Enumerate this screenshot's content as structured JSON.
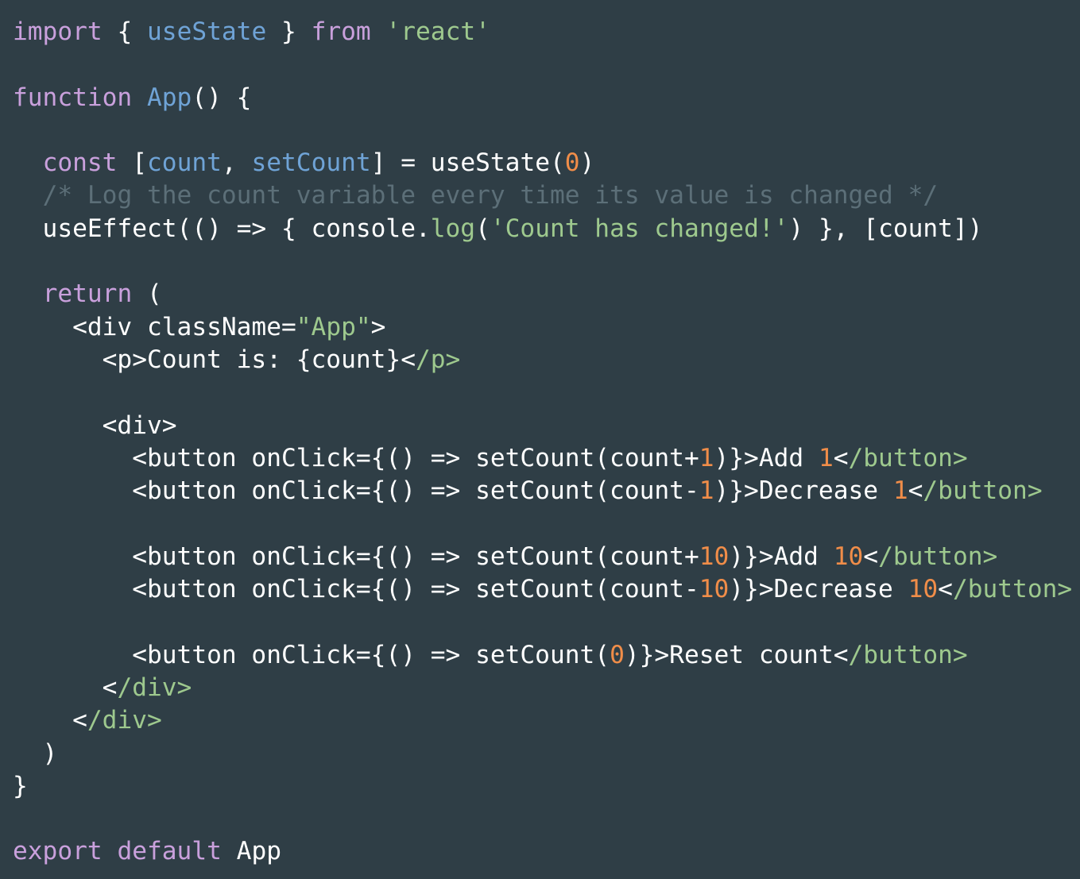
{
  "editor": {
    "background": "#2f3e46",
    "colors": {
      "keyword": "#c9a0dc",
      "identifier": "#6fa3d6",
      "string": "#9ec98e",
      "number": "#f08d49",
      "comment": "#5c6f78",
      "plain": "#ffffff"
    },
    "lines": [
      [
        [
          "keyword",
          "import"
        ],
        [
          "plain",
          " { "
        ],
        [
          "identifier",
          "useState"
        ],
        [
          "plain",
          " } "
        ],
        [
          "keyword",
          "from"
        ],
        [
          "plain",
          " "
        ],
        [
          "string",
          "'react'"
        ]
      ],
      [],
      [
        [
          "keyword",
          "function"
        ],
        [
          "plain",
          " "
        ],
        [
          "identifier",
          "App"
        ],
        [
          "plain",
          "() {"
        ]
      ],
      [],
      [
        [
          "plain",
          "  "
        ],
        [
          "keyword",
          "const"
        ],
        [
          "plain",
          " ["
        ],
        [
          "identifier",
          "count"
        ],
        [
          "plain",
          ", "
        ],
        [
          "identifier",
          "setCount"
        ],
        [
          "plain",
          "] = useState("
        ],
        [
          "number",
          "0"
        ],
        [
          "plain",
          ")"
        ]
      ],
      [
        [
          "plain",
          "  "
        ],
        [
          "comment",
          "/* Log the count variable every time its value is changed */"
        ]
      ],
      [
        [
          "plain",
          "  useEffect(() => { console."
        ],
        [
          "string",
          "log"
        ],
        [
          "plain",
          "("
        ],
        [
          "string",
          "'Count has changed!'"
        ],
        [
          "plain",
          ") }, [count])"
        ]
      ],
      [],
      [
        [
          "plain",
          "  "
        ],
        [
          "keyword",
          "return"
        ],
        [
          "plain",
          " ("
        ]
      ],
      [
        [
          "plain",
          "    <div className="
        ],
        [
          "string",
          "\"App\""
        ],
        [
          "plain",
          ">"
        ]
      ],
      [
        [
          "plain",
          "      <p>Count is: {count}<"
        ],
        [
          "string",
          "/p>"
        ]
      ],
      [],
      [
        [
          "plain",
          "      <div>"
        ]
      ],
      [
        [
          "plain",
          "        <button onClick={() => setCount(count+"
        ],
        [
          "number",
          "1"
        ],
        [
          "plain",
          ")}>Add "
        ],
        [
          "number",
          "1"
        ],
        [
          "plain",
          "<"
        ],
        [
          "string",
          "/button>"
        ]
      ],
      [
        [
          "plain",
          "        <button onClick={() => setCount(count-"
        ],
        [
          "number",
          "1"
        ],
        [
          "plain",
          ")}>Decrease "
        ],
        [
          "number",
          "1"
        ],
        [
          "plain",
          "<"
        ],
        [
          "string",
          "/button>"
        ]
      ],
      [],
      [
        [
          "plain",
          "        <button onClick={() => setCount(count+"
        ],
        [
          "number",
          "10"
        ],
        [
          "plain",
          ")}>Add "
        ],
        [
          "number",
          "10"
        ],
        [
          "plain",
          "<"
        ],
        [
          "string",
          "/button>"
        ]
      ],
      [
        [
          "plain",
          "        <button onClick={() => setCount(count-"
        ],
        [
          "number",
          "10"
        ],
        [
          "plain",
          ")}>Decrease "
        ],
        [
          "number",
          "10"
        ],
        [
          "plain",
          "<"
        ],
        [
          "string",
          "/button>"
        ]
      ],
      [],
      [
        [
          "plain",
          "        <button onClick={() => setCount("
        ],
        [
          "number",
          "0"
        ],
        [
          "plain",
          ")}>Reset count<"
        ],
        [
          "string",
          "/button>"
        ]
      ],
      [
        [
          "plain",
          "      <"
        ],
        [
          "string",
          "/div>"
        ]
      ],
      [
        [
          "plain",
          "    <"
        ],
        [
          "string",
          "/div>"
        ]
      ],
      [
        [
          "plain",
          "  )"
        ]
      ],
      [
        [
          "plain",
          "}"
        ]
      ],
      [],
      [
        [
          "keyword",
          "export"
        ],
        [
          "plain",
          " "
        ],
        [
          "keyword",
          "default"
        ],
        [
          "plain",
          " App"
        ]
      ]
    ]
  }
}
